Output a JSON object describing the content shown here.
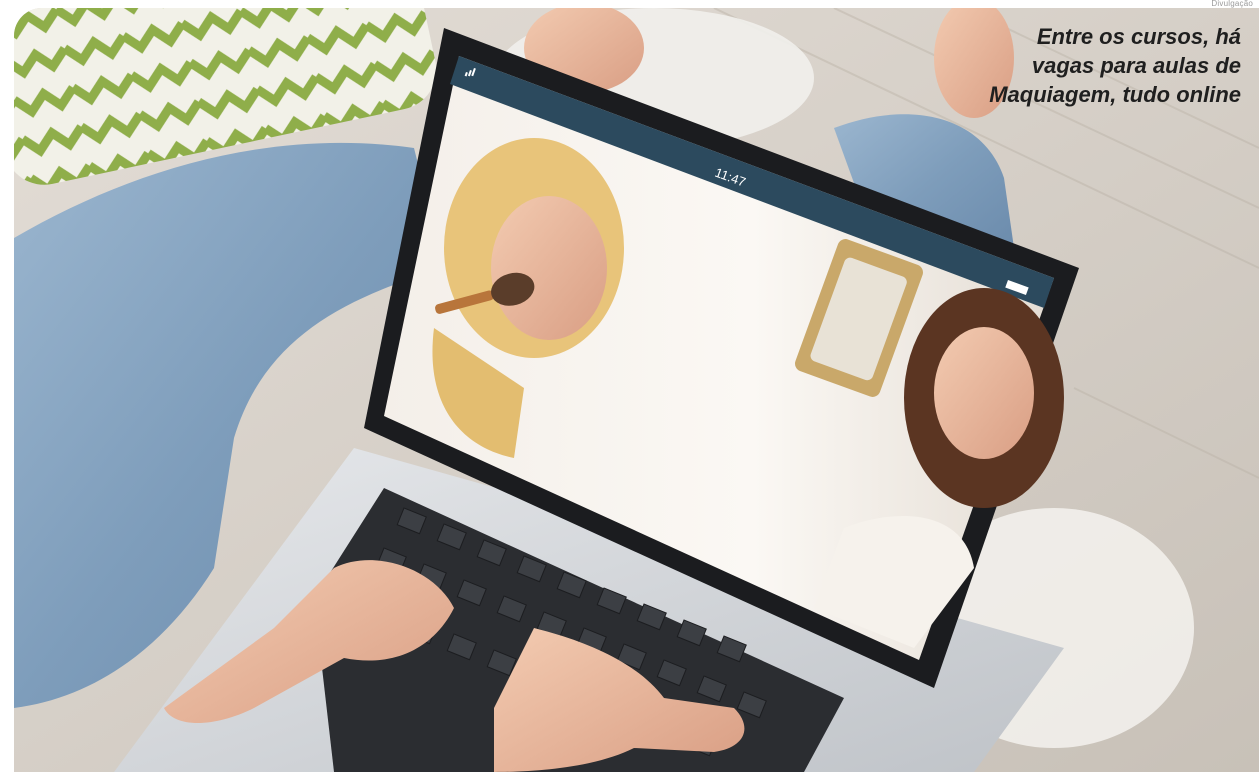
{
  "credit": "Divulgação",
  "caption": "Entre os cursos, há vagas para aulas de Maquiagem, tudo online",
  "laptop_screen": {
    "time": "11:47"
  },
  "colors": {
    "jeans": "#7fa0c0",
    "pillow_green": "#8fae4a",
    "laptop_silver": "#d8dadd",
    "screen_bar": "#2c4a5e",
    "caption_text": "#1f1f1f"
  }
}
